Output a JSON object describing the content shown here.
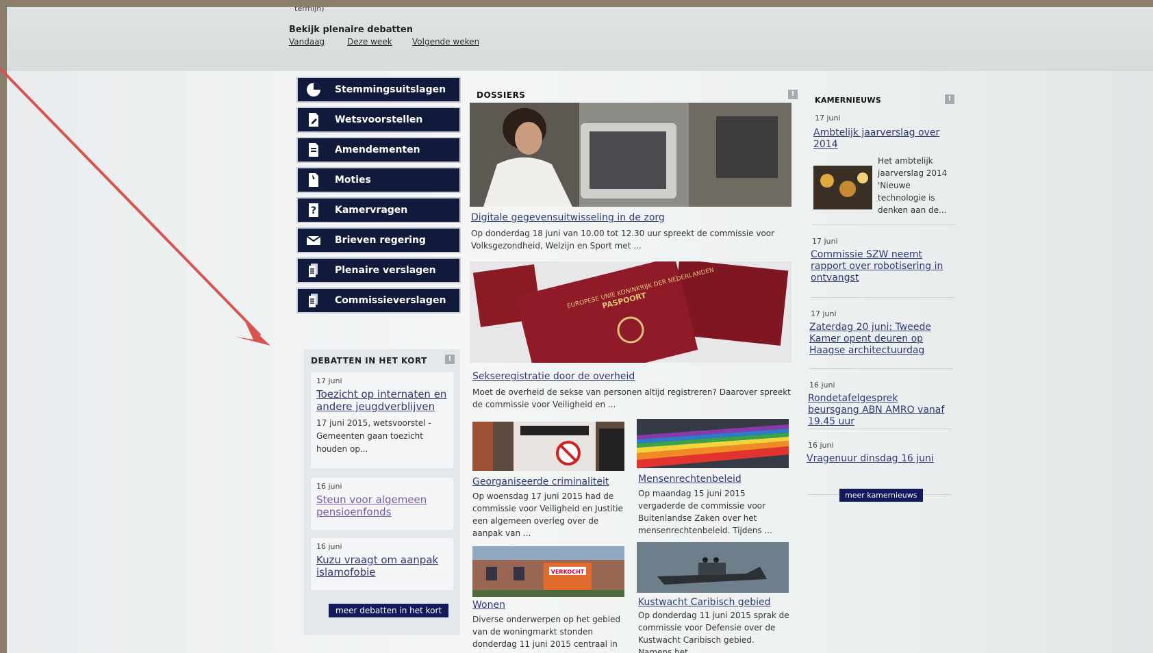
{
  "topbar": {
    "cut_text": "termijn)",
    "label": "Bekijk plenaire debatten",
    "links": [
      "Vandaag",
      "Deze week",
      "Volgende weken"
    ]
  },
  "sidebar": {
    "items": [
      {
        "label": "Stemmingsuitslagen",
        "icon": "pie-chart-icon"
      },
      {
        "label": "Wetsvoorstellen",
        "icon": "document-pen-icon"
      },
      {
        "label": "Amendementen",
        "icon": "document-edit-icon"
      },
      {
        "label": "Moties",
        "icon": "document-hand-icon"
      },
      {
        "label": "Kamervragen",
        "icon": "question-document-icon"
      },
      {
        "label": "Brieven regering",
        "icon": "envelope-icon"
      },
      {
        "label": "Plenaire verslagen",
        "icon": "stacked-documents-icon"
      },
      {
        "label": "Commissieverslagen",
        "icon": "stacked-documents-icon"
      }
    ]
  },
  "debatten": {
    "title": "DEBATTEN IN HET KORT",
    "items": [
      {
        "date": "17 juni",
        "title": "Toezicht op internaten en andere jeugdverblijven",
        "summary": "17 juni 2015, wetsvoorstel - Gemeenten gaan toezicht houden op..."
      },
      {
        "date": "16 juni",
        "title": "Steun voor algemeen pensioenfonds"
      },
      {
        "date": "16 juni",
        "title": "Kuzu vraagt om aanpak islamofobie"
      }
    ],
    "more": "meer debatten in het kort"
  },
  "dossiers": {
    "title": "DOSSIERS",
    "items": [
      {
        "title": "Digitale gegevensuitwisseling in de zorg",
        "summary": "Op donderdag 18 juni van 10.00 tot 12.30 uur spreekt de commissie voor Volksgezondheid, Welzijn en Sport met ..."
      },
      {
        "title": "Sekseregistratie door de overheid",
        "summary": "Moet de overheid de sekse van personen altijd registreren? Daarover spreekt de commissie voor Veiligheid en ..."
      },
      {
        "title": "Georganiseerde criminaliteit",
        "summary": "Op woensdag 17 juni 2015 had de commissie voor Veiligheid en Justitie een algemeen overleg over de aanpak van ..."
      },
      {
        "title": "Mensenrechtenbeleid",
        "summary": "Op maandag 15 juni 2015 vergaderde de commissie voor Buitenlandse Zaken over het mensenrechtenbeleid. Tijdens ..."
      },
      {
        "title": "Wonen",
        "summary": "Diverse onderwerpen op het gebied van de woningmarkt stonden donderdag 11 juni 2015 centraal in"
      },
      {
        "title": "Kustwacht Caribisch gebied",
        "summary": "Op donderdag 11 juni 2015 sprak de commissie voor Defensie over de Kustwacht Caribisch gebied. Namens het ..."
      }
    ],
    "photo_texts": {
      "passport": "PASPOORT",
      "passport_header": "EUROPESE UNIE KONINKRIJK DER NEDERLANDEN",
      "sign": "VERKOCHT"
    }
  },
  "kamernieuws": {
    "title": "KAMERNIEUWS",
    "items": [
      {
        "date": "17 juni",
        "title": "Ambtelijk jaarverslag over 2014",
        "summary": "Het ambtelijk jaarverslag 2014 'Nieuwe technologie is denken aan de..."
      },
      {
        "date": "17 juni",
        "title": "Commissie SZW neemt rapport over robotisering in ontvangst"
      },
      {
        "date": "17 juni",
        "title": "Zaterdag 20 juni: Tweede Kamer opent deuren op Haagse architectuurdag"
      },
      {
        "date": "16 juni",
        "title": "Rondetafelgesprek beursgang ABN AMRO vanaf 19.45 uur"
      },
      {
        "date": "16 juni",
        "title": "Vragenuur dinsdag 16 juni"
      }
    ],
    "more": "meer kamernieuws"
  },
  "colors": {
    "nav_bg": "#121a3c",
    "link": "#2f3a75",
    "arrow": "#d9534f"
  },
  "arrow": {
    "icon": "red-arrow-annotation"
  }
}
